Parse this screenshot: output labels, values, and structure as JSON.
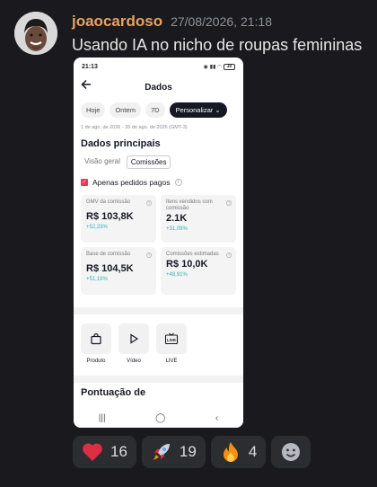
{
  "message": {
    "username": "joaocardoso",
    "timestamp": "27/08/2026, 21:18",
    "text": "Usando IA no nicho de roupas femininas"
  },
  "phone": {
    "status_time": "21:13",
    "battery": "10",
    "title": "Dados",
    "periods": [
      "Hoje",
      "Ontem",
      "7D"
    ],
    "custom_label": "Personalizar",
    "date_range": "1 de ago. de 2026 - 26 de ago. de 2026 (GMT-3)",
    "section_title": "Dados principais",
    "tabs": [
      "Visão geral",
      "Comissões"
    ],
    "checkbox_label": "Apenas pedidos pagos",
    "cards": [
      {
        "label": "GMV da comissão",
        "value": "R$ 103,8K",
        "delta": "+52,23%"
      },
      {
        "label": "Itens vendidos com comissão",
        "value": "2.1K",
        "delta": "+31,09%"
      },
      {
        "label": "Base de comissão",
        "value": "R$ 104,5K",
        "delta": "+51,19%"
      },
      {
        "label": "Comissões estimadas",
        "value": "R$ 10,0K",
        "delta": "+48,91%"
      }
    ],
    "content_types": [
      "Produto",
      "Vídeo",
      "LIVE"
    ],
    "section2_title": "Pontuação de"
  },
  "reactions": [
    {
      "emoji": "heart-emoji",
      "count": "16"
    },
    {
      "emoji": "rocket-emoji",
      "count": "19"
    },
    {
      "emoji": "fire-emoji",
      "count": "4"
    }
  ],
  "colors": {
    "username": "#e8a360",
    "accent_red": "#e63957",
    "delta_green": "#2fb3ab"
  }
}
